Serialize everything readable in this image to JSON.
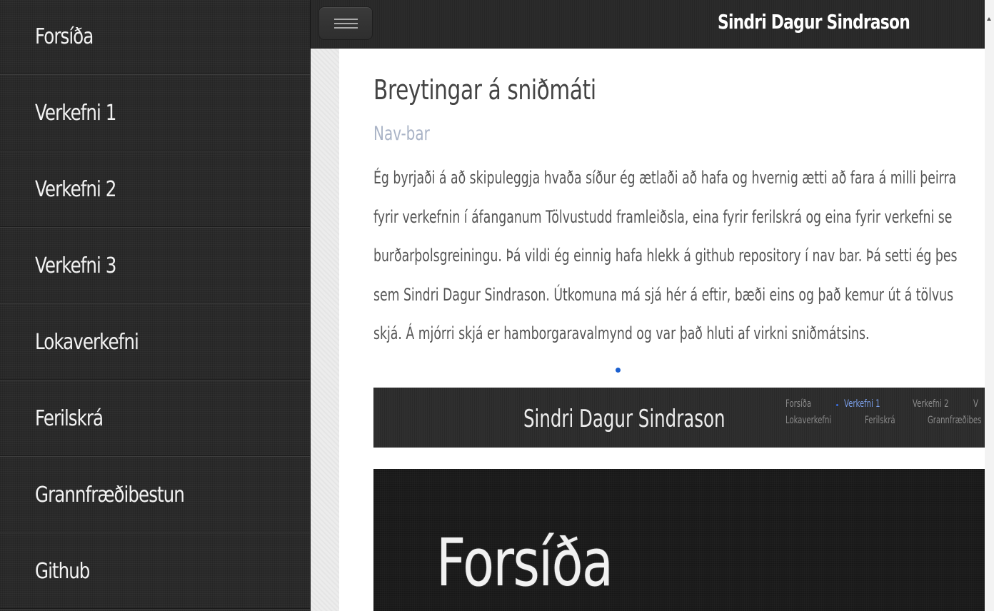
{
  "sidebar": {
    "items": [
      {
        "label": "Forsíða"
      },
      {
        "label": "Verkefni 1"
      },
      {
        "label": "Verkefni 2"
      },
      {
        "label": "Verkefni 3"
      },
      {
        "label": "Lokaverkefni"
      },
      {
        "label": "Ferilskrá"
      },
      {
        "label": "Grannfræðibestun"
      },
      {
        "label": "Github"
      }
    ]
  },
  "header": {
    "menu_icon": "hamburger-icon",
    "title": "Sindri Dagur Sindrason"
  },
  "main": {
    "heading": "Breytingar á sniðmáti",
    "subheading": "Nav-bar",
    "paragraph_lines": [
      "Ég byrjaði á að skipuleggja hvaða síður ég ætlaði að hafa og hvernig ætti að fara á milli þeirra",
      "fyrir verkefnin í áfanganum Tölvustudd framleiðsla, eina fyrir ferilskrá og eina fyrir verkefni se",
      "burðarþolsgreiningu. Þá vildi ég einnig hafa hlekk á github repository í nav bar. Þá setti ég þes",
      "sem Sindri Dagur Sindrason. Útkomuna má sjá hér á eftir, bæði eins og það kemur út á tölvus",
      "skjá. Á mjórri skjá er hamborgaravalmynd og var það hluti af virkni sniðmátsins."
    ],
    "preview_nav": {
      "brand": "Sindri Dagur Sindrason",
      "links_row1": [
        "Forsíða",
        "Verkefni 1",
        "Verkefni 2",
        "V"
      ],
      "links_row2": [
        "Lokaverkefni",
        "Ferilskrá",
        "Grannfræðibes"
      ],
      "active_link": "Verkefni 1"
    },
    "preview_big": {
      "label": "Forsíða"
    }
  },
  "colors": {
    "sidebar_bg": "#2a2a2a",
    "header_bg": "#2b2b2b",
    "subheading": "#a9b3c6",
    "dot_accent": "#1a5fd0"
  }
}
